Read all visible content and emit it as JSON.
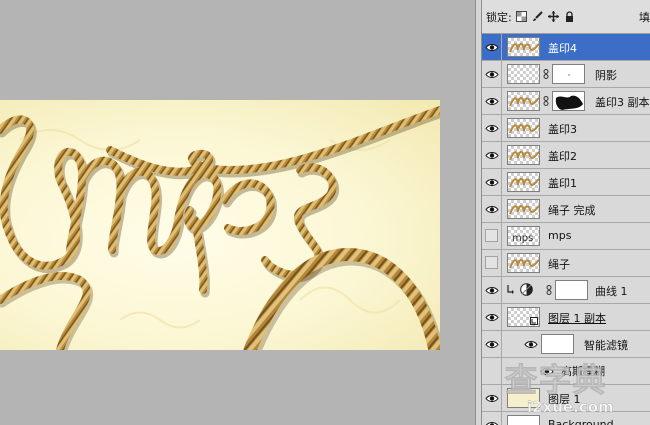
{
  "lock_bar": {
    "label": "锁定:",
    "fill_label": "填"
  },
  "layers": [
    {
      "name": "盖印4",
      "visible": true,
      "selected": true,
      "thumb": "rope"
    },
    {
      "name": "阴影",
      "visible": true,
      "thumb": "checker",
      "mask": "white"
    },
    {
      "name": "盖印3 副本",
      "visible": true,
      "thumb": "rope",
      "mask": "black-shape"
    },
    {
      "name": "盖印3",
      "visible": true,
      "thumb": "rope"
    },
    {
      "name": "盖印2",
      "visible": true,
      "thumb": "rope"
    },
    {
      "name": "盖印1",
      "visible": true,
      "thumb": "rope"
    },
    {
      "name": "绳子 完成",
      "visible": true,
      "thumb": "rope"
    },
    {
      "name": "mps",
      "visible": false,
      "thumb": "text"
    },
    {
      "name": "绳子",
      "visible": false,
      "thumb": "rope"
    },
    {
      "name": "曲线 1",
      "visible": true,
      "thumb": "white",
      "adjustment": true
    },
    {
      "name": "图层 1 副本",
      "visible": true,
      "thumb": "checker",
      "smart_object": true
    },
    {
      "name": "智能滤镜",
      "visible": true,
      "thumb": "white",
      "filter_mask": true
    },
    {
      "name": "高斯模糊",
      "visible": true,
      "filter": true
    },
    {
      "name": "图层 1",
      "visible": true,
      "thumb": "cream"
    },
    {
      "name": "Background",
      "visible": true,
      "thumb": "white"
    }
  ],
  "watermark": {
    "title": "查字典",
    "subtitle": "i2xue.com"
  },
  "colors": {
    "selection": "#3c6ec8",
    "canvas_bg": "#b4b4b4",
    "panel_bg": "#d9d9d9"
  }
}
